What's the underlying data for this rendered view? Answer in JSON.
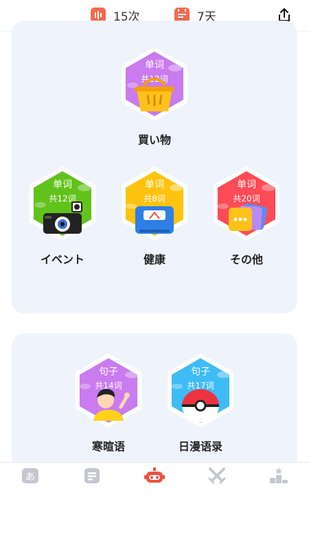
{
  "header": {
    "streak_count": "15次",
    "days_count": "7天",
    "streak_icon": "chart-bars-icon",
    "days_icon": "calendar-icon",
    "share_icon": "share-icon"
  },
  "section1": {
    "items": [
      {
        "type": "单词",
        "count": "共12词",
        "label": "買い物",
        "color": "#c97bef",
        "icon": "shopping-basket-icon"
      },
      {
        "type": "单词",
        "count": "共12词",
        "label": "イベント",
        "color": "#62c21c",
        "icon": "camera-icon"
      },
      {
        "type": "单词",
        "count": "共8词",
        "label": "健康",
        "color": "#ffc30f",
        "icon": "scale-icon"
      },
      {
        "type": "单词",
        "count": "共20词",
        "label": "その他",
        "color": "#ff4b55",
        "icon": "more-cards-icon"
      }
    ]
  },
  "section2": {
    "items": [
      {
        "type": "句子",
        "count": "共14词",
        "label": "寒暄语",
        "color": "#c97bef",
        "icon": "waving-boy-icon"
      },
      {
        "type": "句子",
        "count": "共17词",
        "label": "日漫语录",
        "color": "#3ebcf5",
        "icon": "pokeball-icon"
      }
    ]
  },
  "tabbar": {
    "tabs": [
      {
        "icon": "kana-icon",
        "active": false
      },
      {
        "icon": "document-icon",
        "active": false
      },
      {
        "icon": "robot-icon",
        "active": true
      },
      {
        "icon": "swords-icon",
        "active": false
      },
      {
        "icon": "ranking-icon",
        "active": false
      }
    ],
    "accent": "#f0513f",
    "inactive": "#c4c7cf"
  }
}
